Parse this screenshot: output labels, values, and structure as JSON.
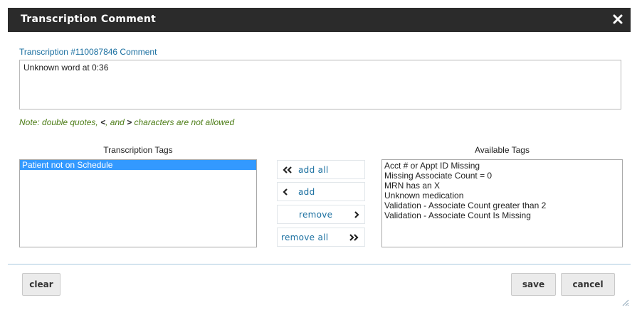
{
  "dialog": {
    "title": "Transcription Comment",
    "close_icon": "close-icon",
    "subtitle": "Transcription #110087846 Comment",
    "comment_value": "Unknown word at 0:36",
    "note": {
      "prefix": "Note: double quotes, ",
      "lt": "<",
      "mid": ", and ",
      "gt": ">",
      "suffix": " characters are not allowed"
    }
  },
  "transcription_tags": {
    "heading": "Transcription Tags",
    "items": [
      "Patient not on Schedule"
    ],
    "selected": "Patient not on Schedule"
  },
  "available_tags": {
    "heading": "Available Tags",
    "items": [
      "Acct # or Appt ID Missing",
      "Missing Associate Count = 0",
      "MRN has an X",
      "Unknown medication",
      "Validation - Associate Count greater than 2",
      "Validation - Associate Count Is Missing"
    ]
  },
  "movers": {
    "add_all": "add all",
    "add": "add",
    "remove": "remove",
    "remove_all": "remove all"
  },
  "footer": {
    "clear": "clear",
    "save": "save",
    "cancel": "cancel"
  },
  "colors": {
    "titlebar": "#2b2b2b",
    "link_blue": "#1a6fa0",
    "note_green": "#4d7d17",
    "selection": "#3399ff"
  }
}
